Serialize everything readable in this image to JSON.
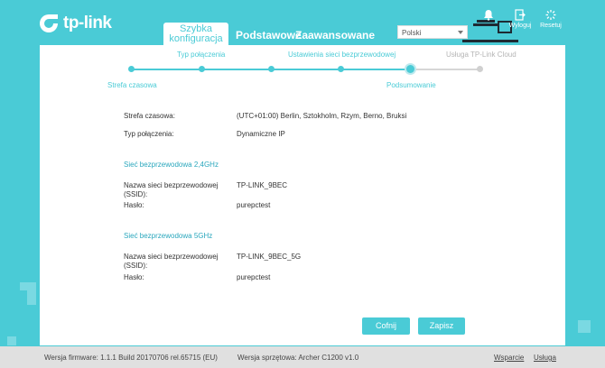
{
  "brand": {
    "name": "tp-link",
    "color": "#4acbd6"
  },
  "nav": {
    "quick_setup_line1": "Szybka",
    "quick_setup_line2": "konfiguracja",
    "basic": "Podstawowe",
    "advanced": "Zaawansowane"
  },
  "language": {
    "selected": "Polski"
  },
  "header_buttons": {
    "logout": "Wyloguj",
    "reboot": "Resetuj"
  },
  "steps": {
    "top": [
      "Typ połączenia",
      "Ustawienia sieci bezprzewodowej",
      "Usługa TP-Link Cloud"
    ],
    "bottom": [
      "Strefa czasowa",
      "Podsumowanie"
    ]
  },
  "summary": {
    "timezone_label": "Strefa czasowa:",
    "timezone_value": "(UTC+01:00) Berlin, Sztokholm, Rzym, Berno, Bruksi",
    "conn_label": "Typ połączenia:",
    "conn_value": "Dynamiczne IP",
    "wifi24_title": "Sieć bezprzewodowa 2,4GHz",
    "wifi5_title": "Sieć bezprzewodowa 5GHz",
    "ssid_label_1": "Nazwa sieci bezprzewodowej",
    "ssid_label_2": "(SSID):",
    "pass_label": "Hasło:",
    "ssid24_value": "TP-LINK_9BEC",
    "pass24_value": "purepctest",
    "ssid5_value": "TP-LINK_9BEC_5G",
    "pass5_value": "purepctest"
  },
  "actions": {
    "back": "Cofnij",
    "save": "Zapisz"
  },
  "footer": {
    "firmware": "Wersja firmware: 1.1.1 Build 20170706 rel.65715 (EU)",
    "hardware": "Wersja sprzętowa: Archer C1200 v1.0",
    "support": "Wsparcie",
    "app": "Usługa"
  }
}
